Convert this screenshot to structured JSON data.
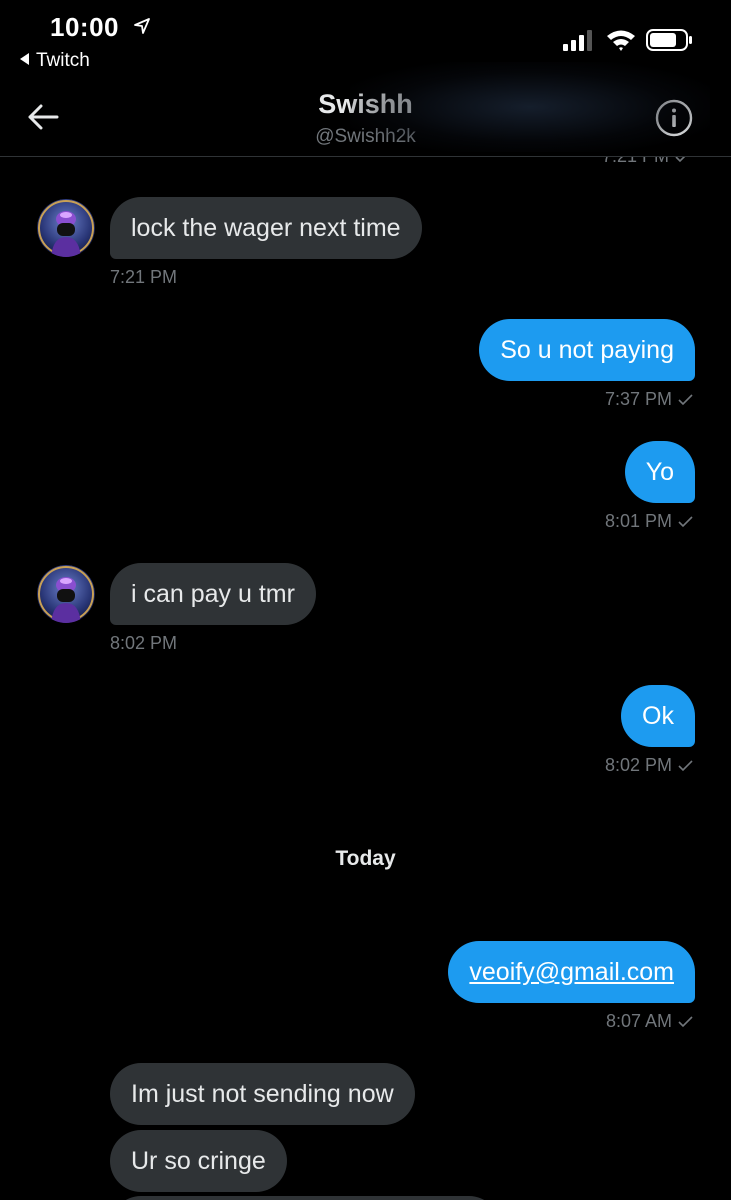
{
  "status_bar": {
    "time": "10:00",
    "back_app": "Twitch"
  },
  "header": {
    "title": "Swishh",
    "handle": "@Swishh2k"
  },
  "conversation": {
    "clipped_timestamp": "7:21 PM",
    "messages": [
      {
        "text": "lock the wager next time",
        "direction": "incoming",
        "timestamp": "7:21 PM"
      },
      {
        "text": "So u not paying",
        "direction": "outgoing",
        "timestamp": "7:37 PM"
      },
      {
        "text": "Yo",
        "direction": "outgoing",
        "timestamp": "8:01 PM"
      },
      {
        "text": "i can pay u tmr",
        "direction": "incoming",
        "timestamp": "8:02 PM"
      },
      {
        "text": "Ok",
        "direction": "outgoing",
        "timestamp": "8:02 PM"
      },
      {
        "text": "veoify@gmail.com",
        "direction": "outgoing",
        "timestamp": "8:07 AM"
      },
      {
        "text": "Im just not sending now",
        "direction": "incoming",
        "timestamp": ""
      },
      {
        "text": "Ur so cringe",
        "direction": "incoming",
        "timestamp": ""
      }
    ],
    "day_separator": "Today"
  },
  "colors": {
    "outgoing_bubble": "#1d9bf0",
    "incoming_bubble": "#2f3336",
    "muted_text": "#71767b",
    "background": "#000000"
  }
}
